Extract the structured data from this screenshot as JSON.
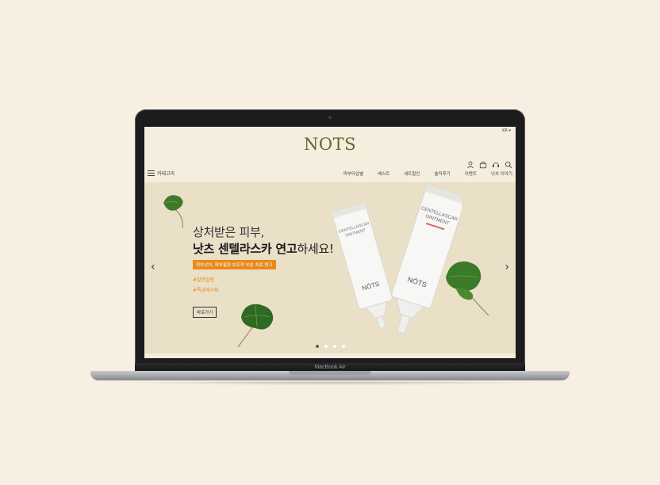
{
  "device": {
    "label": "MacBook Air"
  },
  "site": {
    "lang": "KR ▾",
    "logo": "NOTS",
    "utility_icons": [
      "user-icon",
      "bag-icon",
      "headset-icon",
      "search-icon"
    ],
    "category_label": "카테고리",
    "menu": [
      "피부타입별",
      "베스트",
      "세트할인",
      "솔직후기",
      "이벤트",
      "낫츠 이야기"
    ]
  },
  "hero": {
    "line1": "상처받은 피부,",
    "line2_bold": "낫츠 센텔라스카 연고",
    "line2_rest": "하세요!",
    "tag": "피부상처, 피부흉양 보조적 부분 치료 연고",
    "hash1": "#말랑말랑",
    "hash2": "#특급레시피",
    "button": "바로가기",
    "product_text": {
      "line1": "CENTELLASCAR",
      "line2": "OINTMENT",
      "brand": "NŌTS"
    },
    "slides": 4,
    "active_slide": 1
  },
  "colors": {
    "brand": "#5b6a2e",
    "accent": "#e88a1a",
    "background": "#f6efe2"
  }
}
